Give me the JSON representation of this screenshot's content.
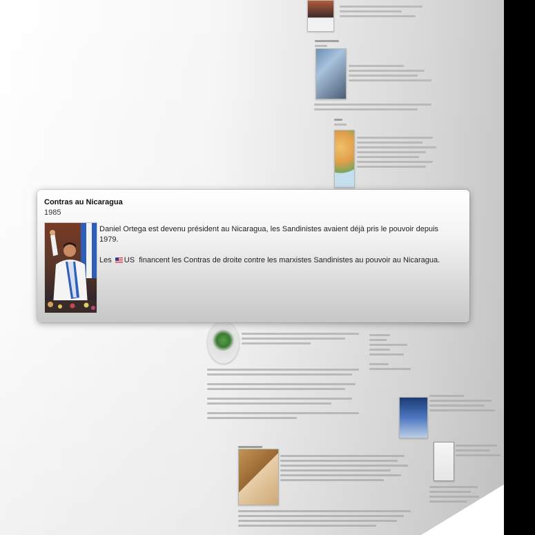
{
  "card": {
    "title": "Contras au Nicaragua",
    "year": "1985",
    "paragraph1": "Daniel Ortega est devenu président au Nicaragua, les Sandinistes avaient déjà pris le pouvoir depuis 1979.",
    "paragraph2_prefix": "Les ",
    "paragraph2_flag_label": "US",
    "paragraph2_suffix": "financent les Contras de droite contre les marxistes Sandinistes au pouvoir au Nicaragua.",
    "flag_icon": "us-flag-icon"
  },
  "colors": {
    "backdrop": "#000000",
    "card_text": "#222222",
    "page_gradient_start": "#ffffff",
    "page_gradient_end": "#c4c4c4"
  }
}
